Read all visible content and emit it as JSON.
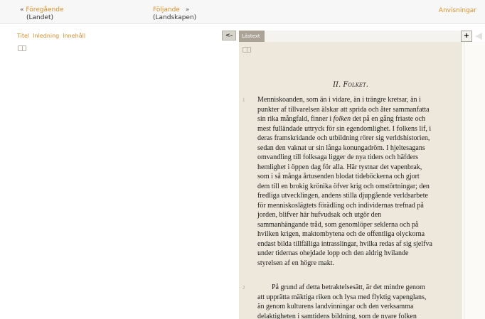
{
  "nav": {
    "prev_label": "Föregående",
    "prev_sub": "(Landet)",
    "prev_chevron": "«",
    "next_label": "Följande",
    "next_sub": "(Landskapen)",
    "next_chevron": "»",
    "help_label": "Anvisningar"
  },
  "left_pane": {
    "tabs": [
      "Titel",
      "Inledning",
      "Innehåll"
    ],
    "book_icon": "open-book-icon"
  },
  "collapse_button": "<-",
  "reader": {
    "tab_label": "Lästext",
    "plus_label": "+",
    "chapter_title": "II. Folket.",
    "paragraphs": [
      {
        "number": "1",
        "lines": [
          "Menniskoanden, som än i vidare, än i trängre kretsar, än i",
          "punkter af tillvarelsen älskar att sprida och åter sammanfatta",
          "sin rika mångfald, finner i folken det på en gång friaste och",
          "mest fulländade uttryck för sin egendomlighet. I folkens lif, i",
          "deras framskridande och utbildning rörer sig verldshistorien,",
          "sedan den vaknat ur sin långa konungadröm. I hjeltesagans",
          "omvandling till folksaga ligger de nya tiders och häfders",
          "hemlighet i öppen dag för alla. Här tystnar det vapenbrak,",
          "som i så många årtusenden blodat tideböckerna och gjort",
          "dem till en brokig krönika öfver krig och omstörtningar; den",
          "fredliga utvecklingen, andens stilla djupgående verldsarbete",
          "för menniskoslägtets förädling och individernas trefnad på",
          "jorden, blifver här hufvudsak och utgör den",
          "sammanhängande tråd, som genomlöper seklerna och på",
          "hvilken krigen, maktombytena och de offentliga olyckorna",
          "endast bilda tillfälliga intrasslingar, hvilka redas af sig sjelfva",
          "under tidernas ohejdade lopp och den aldrig hvilande",
          "styrelsen af en högre makt."
        ]
      },
      {
        "number": "2",
        "lines": [
          "        På grund af detta betraktelsesätt, är det mindre genom",
          "att upprätta mäktiga riken och lysa med flyktig vapenglans,",
          "än genom kulturens landvinningar och den verksamma",
          "delaktigheten i samtidens bildning, som de nyare folken"
        ]
      }
    ]
  }
}
